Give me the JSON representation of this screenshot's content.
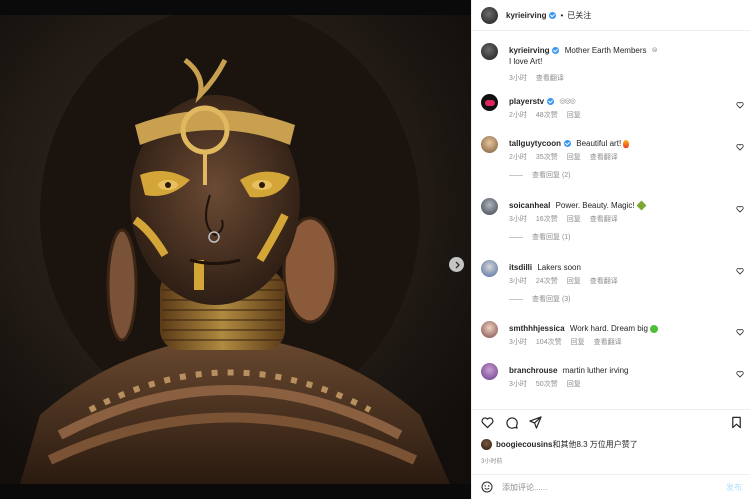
{
  "post": {
    "author": "kyrieirving",
    "follow_separator": "•",
    "follow_label": "已关注",
    "caption_user": "kyrieirving",
    "caption_text": "Mother Earth Members",
    "caption_line2": "I love Art!",
    "caption_time": "3小时",
    "caption_translate": "查看翻译"
  },
  "comments": [
    {
      "user": "playerstv",
      "text": "",
      "time": "2小时",
      "likes": "48次赞",
      "reply": "回复",
      "view_replies": ""
    },
    {
      "user": "tallguytycoon",
      "text": "Beautiful art!",
      "time": "2小时",
      "likes": "35次赞",
      "reply": "回复",
      "translate": "查看翻译",
      "view_replies": "查看回复 (2)"
    },
    {
      "user": "soicanheal",
      "text": "Power. Beauty. Magic!",
      "time": "3小时",
      "likes": "16次赞",
      "reply": "回复",
      "translate": "查看翻译",
      "view_replies": "查看回复 (1)"
    },
    {
      "user": "itsdilli",
      "text": "Lakers soon",
      "time": "3小时",
      "likes": "24次赞",
      "reply": "回复",
      "translate": "查看翻译",
      "view_replies": "查看回复 (3)"
    },
    {
      "user": "smthhhjessica",
      "text": "Work hard. Dream big",
      "time": "3小时",
      "likes": "104次赞",
      "reply": "回复",
      "translate": "查看翻译",
      "view_replies": ""
    },
    {
      "user": "branchrouse",
      "text": "martin luther irving",
      "time": "3小时",
      "likes": "50次赞",
      "reply": "回复",
      "view_replies": ""
    }
  ],
  "likes": {
    "user": "boogiecousins",
    "text": "和其他8.3 万位用户赞了"
  },
  "post_time": "3小时前",
  "add_comment": {
    "placeholder": "添加评论......",
    "post_label": "发布"
  },
  "carousel": {
    "count": 7,
    "active": 0
  },
  "colors": {
    "accent": "#3897f0",
    "post_disabled": "#b2dffc"
  },
  "icons": [
    "heart-icon",
    "comment-icon",
    "share-icon",
    "bookmark-icon",
    "emoji-icon",
    "chevron-right-icon",
    "verified-icon"
  ]
}
